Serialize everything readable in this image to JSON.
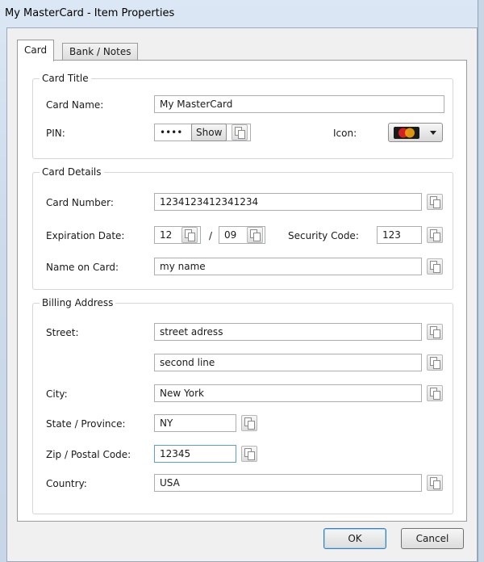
{
  "window": {
    "title": "My MasterCard - Item Properties"
  },
  "tabs": [
    {
      "label": "Card",
      "active": true
    },
    {
      "label": "Bank / Notes",
      "active": false
    }
  ],
  "card_title": {
    "legend": "Card Title",
    "card_name_label": "Card Name:",
    "card_name_value": "My MasterCard",
    "pin_label": "PIN:",
    "pin_value": "••••",
    "show_button": "Show",
    "icon_label": "Icon:",
    "icon_selected": "mastercard-icon"
  },
  "card_details": {
    "legend": "Card Details",
    "card_number_label": "Card Number:",
    "card_number_value": "1234123412341234",
    "expiration_label": "Expiration Date:",
    "exp_month": "12",
    "exp_separator": "/",
    "exp_year": "09",
    "security_label": "Security Code:",
    "security_value": "123",
    "name_label": "Name on Card:",
    "name_value": "my name"
  },
  "billing": {
    "legend": "Billing Address",
    "street_label": "Street:",
    "street_line1": "street adress",
    "street_line2": "second line",
    "city_label": "City:",
    "city_value": "New York",
    "state_label": "State / Province:",
    "state_value": "NY",
    "zip_label": "Zip / Postal Code:",
    "zip_value": "12345",
    "country_label": "Country:",
    "country_value": "USA"
  },
  "buttons": {
    "ok": "OK",
    "cancel": "Cancel"
  },
  "colors": {
    "window_frame": "#cddbeb",
    "focus_border": "#5aa0d6",
    "default_button": "#3c7fb1"
  }
}
